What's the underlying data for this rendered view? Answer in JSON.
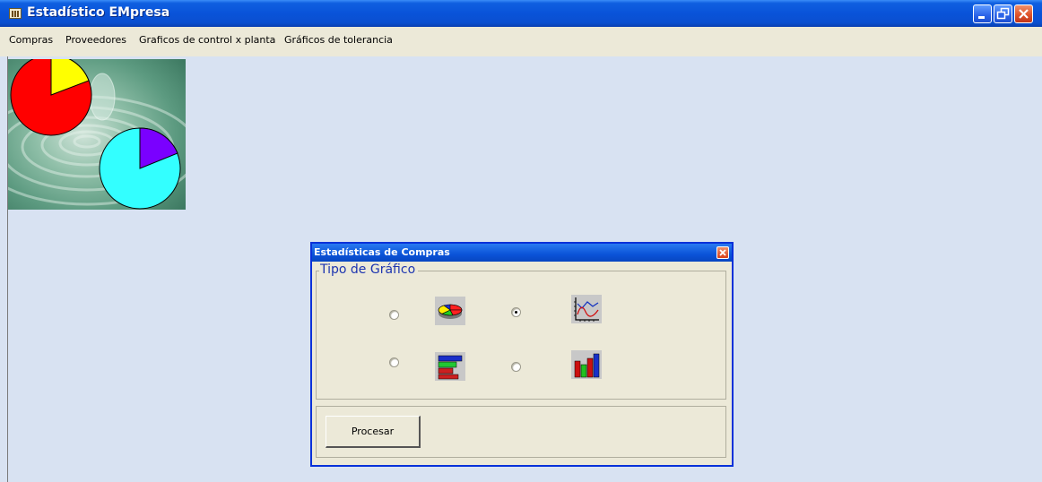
{
  "window": {
    "title": "Estadístico EMpresa"
  },
  "menu": [
    "Compras",
    "Proveedores",
    "Graficos de control x planta",
    "Gráficos de tolerancia"
  ],
  "dialog": {
    "title": "Estadísticas de Compras",
    "group_label": "Tipo de Gráfico",
    "options": [
      {
        "icon": "pie-chart-icon",
        "checked": false
      },
      {
        "icon": "line-chart-icon",
        "checked": true
      },
      {
        "icon": "horizontal-bar-chart-icon",
        "checked": false
      },
      {
        "icon": "vertical-bar-chart-icon",
        "checked": false
      }
    ],
    "process_label": "Procesar"
  },
  "colors": {
    "titlebar": "#0953d9",
    "dialog_bg": "#ece9d8",
    "mdi_bg": "#d8e2f2",
    "legend_text": "#1d35b0"
  }
}
